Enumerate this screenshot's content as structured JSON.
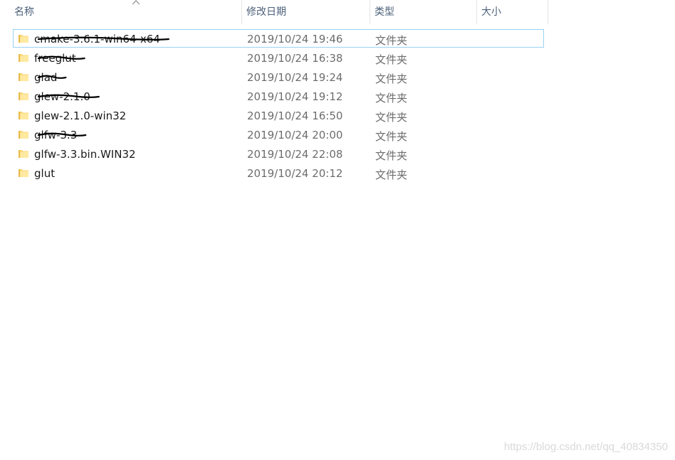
{
  "columns": {
    "name": "名称",
    "date": "修改日期",
    "type": "类型",
    "size": "大小"
  },
  "sort_indicator_icon": "chevron-up-icon",
  "rows": [
    {
      "name": "cmake-3.6.1-win64-x64",
      "date": "2019/10/24 19:46",
      "type": "文件夹",
      "selected": true,
      "struck": true
    },
    {
      "name": "freeglut",
      "date": "2019/10/24 16:38",
      "type": "文件夹",
      "selected": false,
      "struck": true
    },
    {
      "name": "glad",
      "date": "2019/10/24 19:24",
      "type": "文件夹",
      "selected": false,
      "struck": true
    },
    {
      "name": "glew-2.1.0",
      "date": "2019/10/24 19:12",
      "type": "文件夹",
      "selected": false,
      "struck": true
    },
    {
      "name": "glew-2.1.0-win32",
      "date": "2019/10/24 16:50",
      "type": "文件夹",
      "selected": false,
      "struck": false
    },
    {
      "name": "glfw-3.3",
      "date": "2019/10/24 20:00",
      "type": "文件夹",
      "selected": false,
      "struck": true
    },
    {
      "name": "glfw-3.3.bin.WIN32",
      "date": "2019/10/24 22:08",
      "type": "文件夹",
      "selected": false,
      "struck": false
    },
    {
      "name": "glut",
      "date": "2019/10/24 20:12",
      "type": "文件夹",
      "selected": false,
      "struck": false
    }
  ],
  "watermark": "https://blog.csdn.net/qq_40834350",
  "colors": {
    "folder": "#f8d775",
    "selection_border": "#99d1f6",
    "header_text": "#4c607a",
    "scribble": "#000000"
  }
}
